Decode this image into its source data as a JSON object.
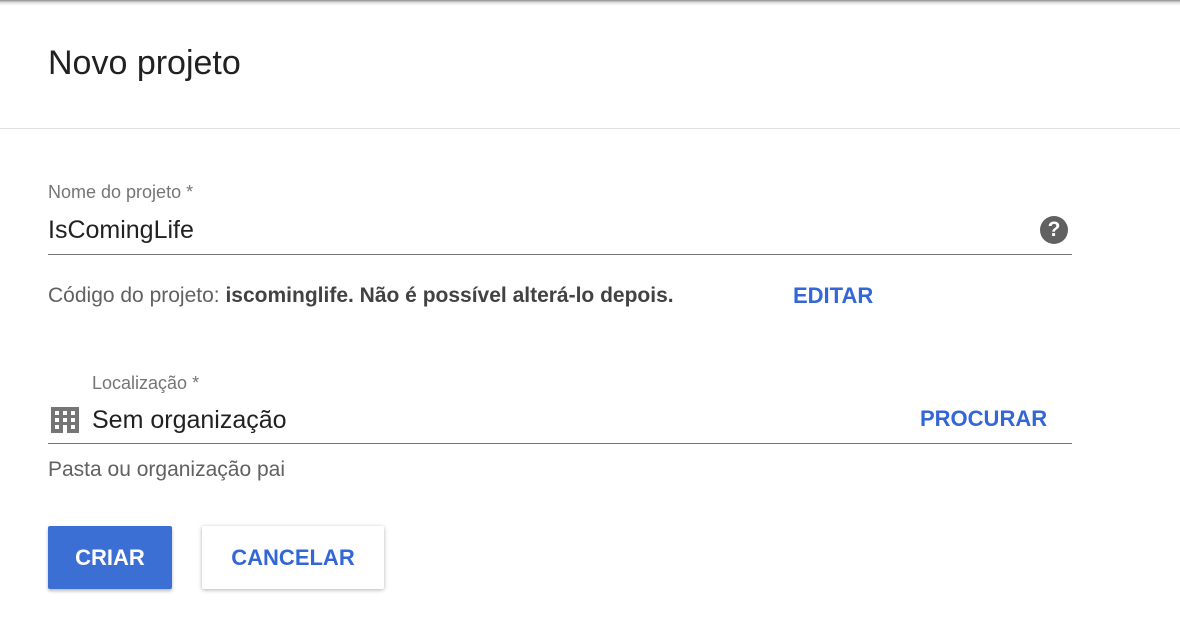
{
  "dialog": {
    "title": "Novo projeto"
  },
  "project_name": {
    "label": "Nome do projeto *",
    "value": "IsComingLife",
    "help_icon": "help-circle-icon"
  },
  "project_code": {
    "prefix": "Código do projeto: ",
    "code": "iscominglife",
    "suffix": ". Não é possível alterá-lo depois.",
    "edit_label": "EDITAR"
  },
  "location": {
    "label": "Localização *",
    "icon": "building-icon",
    "value": "Sem organização",
    "browse_label": "PROCURAR",
    "hint": "Pasta ou organização pai"
  },
  "actions": {
    "create_label": "CRIAR",
    "cancel_label": "CANCELAR"
  },
  "colors": {
    "accent": "#3367d6",
    "primary_button": "#3b6fd4"
  }
}
